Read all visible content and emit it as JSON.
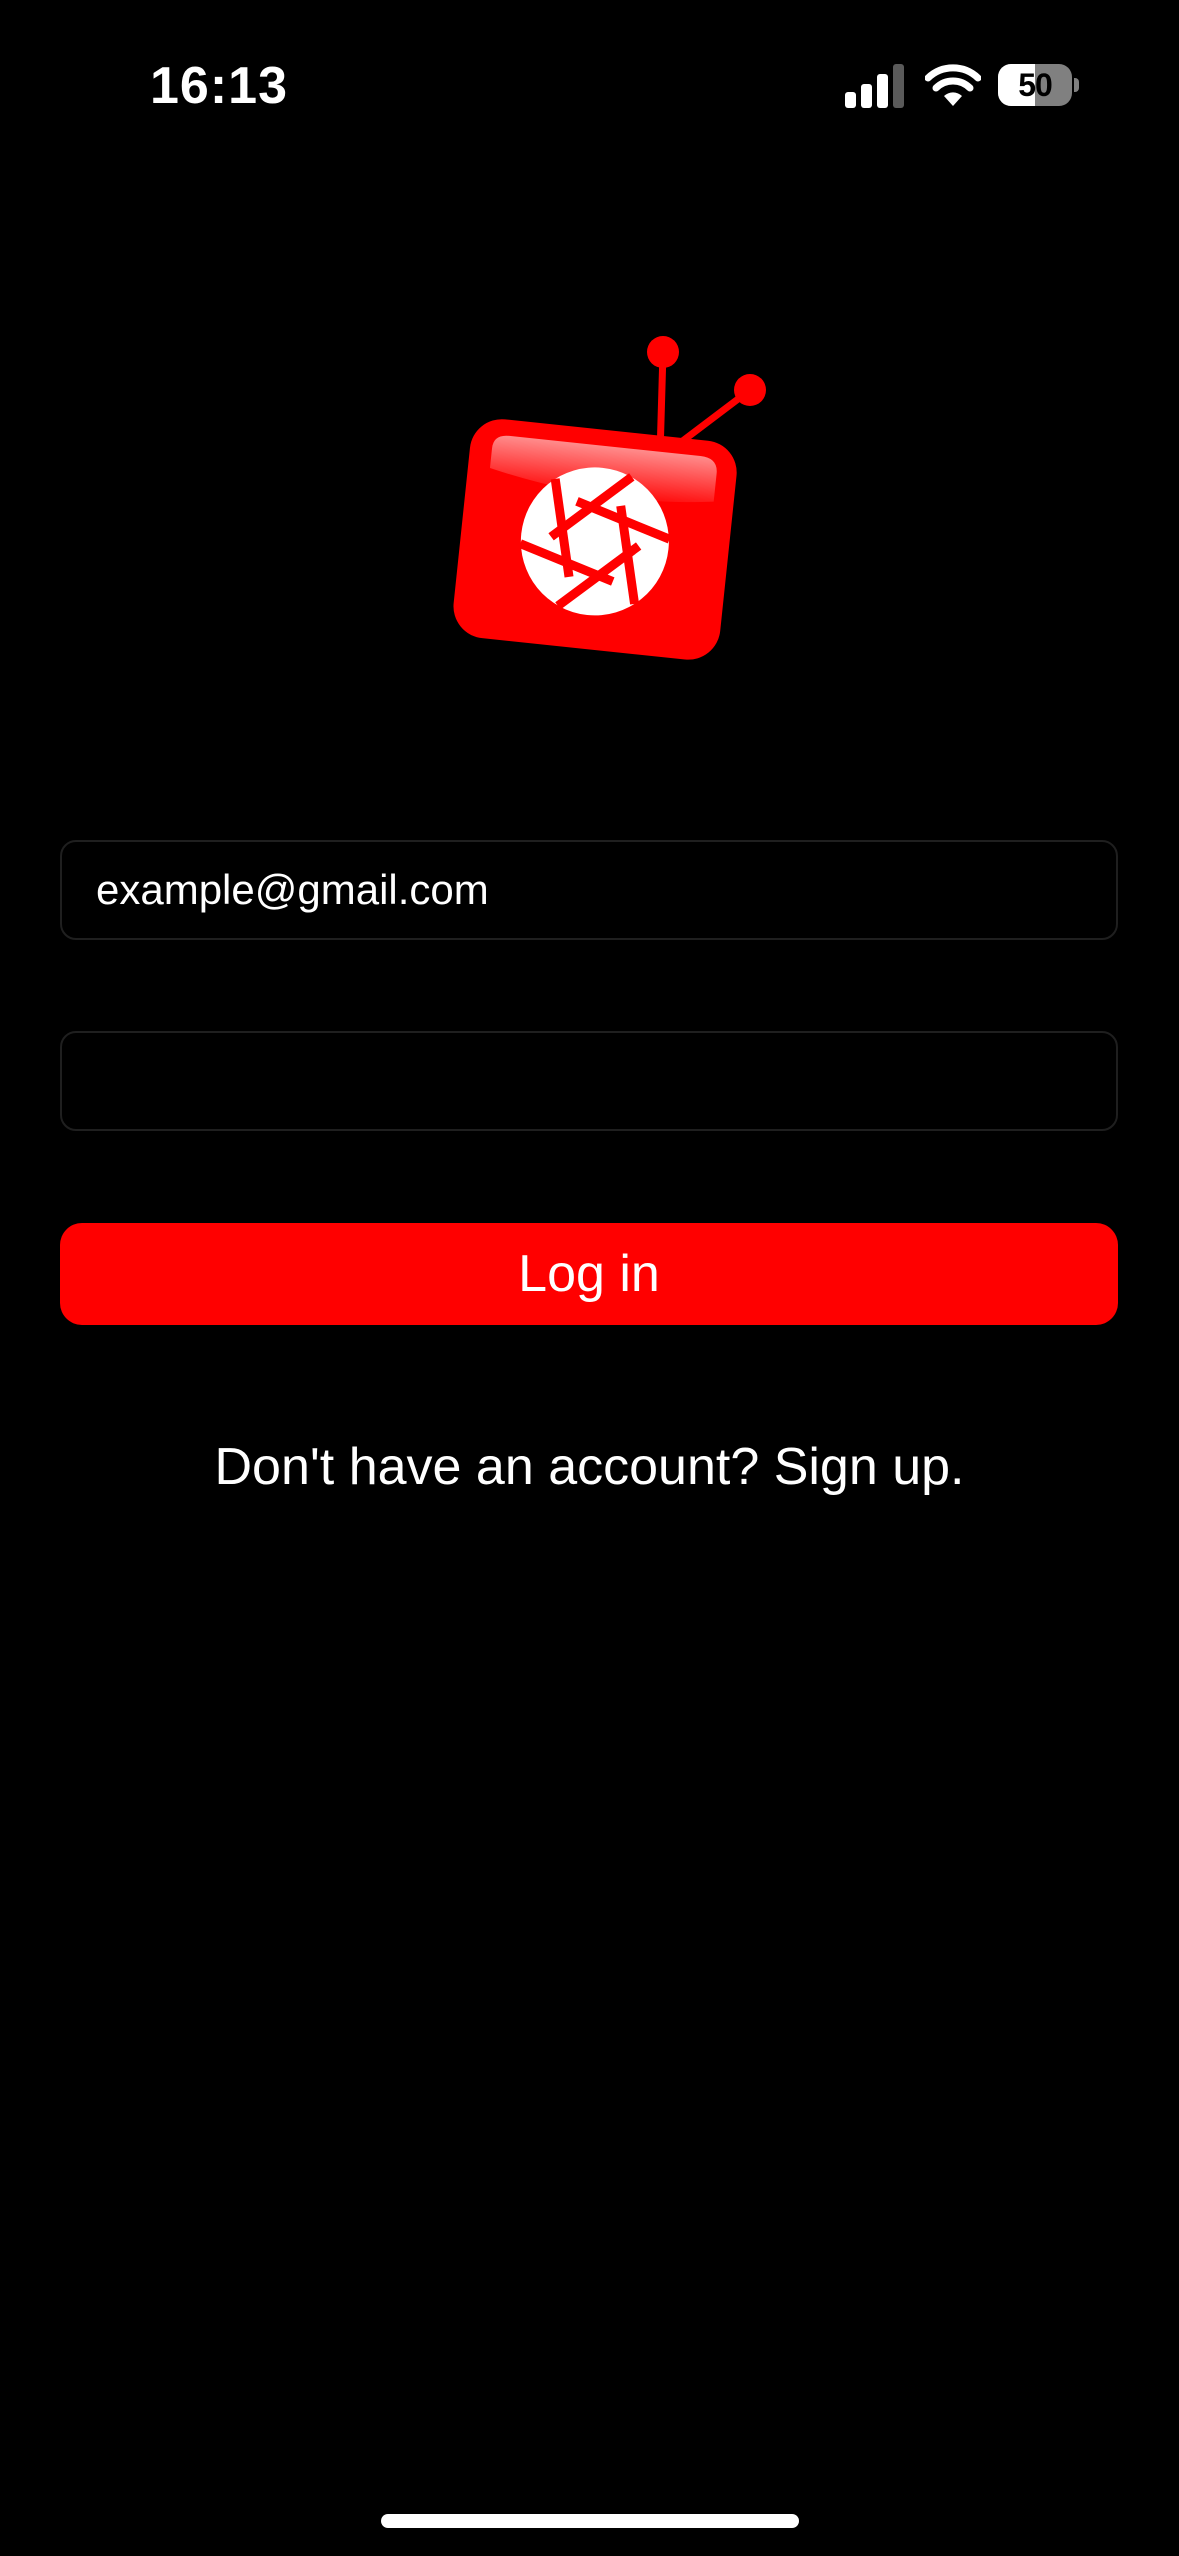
{
  "status_bar": {
    "time": "16:13",
    "battery_level": "50",
    "battery_fraction": 0.5,
    "signal_icon": "cellular-signal-icon",
    "wifi_icon": "wifi-icon"
  },
  "logo": {
    "icon": "tv-camera-shutter-logo"
  },
  "login_form": {
    "email_placeholder": "example@gmail.com",
    "email_value": "",
    "password_placeholder": "",
    "password_value": "",
    "login_label": "Log in",
    "signup_text": "Don't have an account? Sign up."
  },
  "colors": {
    "background": "#000000",
    "accent": "#ff0000",
    "text": "#ffffff",
    "field_border": "#1f1f1f"
  }
}
